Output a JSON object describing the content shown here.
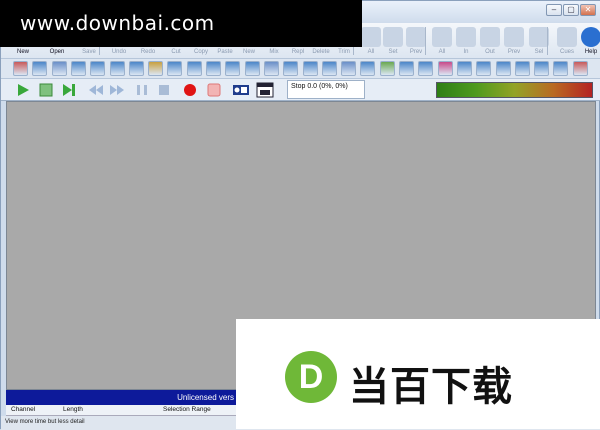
{
  "window": {
    "minimize_glyph": "–",
    "maximize_glyph": "▢",
    "close_glyph": "✕"
  },
  "toolbar_main": [
    {
      "name": "new-button",
      "label": "New",
      "icon": "new-file-icon",
      "enabled": true
    },
    {
      "name": "open-button",
      "label": "Open",
      "icon": "folder-open-icon",
      "enabled": true
    },
    {
      "name": "save-button",
      "label": "Save",
      "icon": "save-disk-icon",
      "enabled": false
    },
    {
      "name": "undo-button",
      "label": "Undo",
      "icon": "undo-arrow-icon",
      "enabled": false
    },
    {
      "name": "redo-button",
      "label": "Redo",
      "icon": "redo-arrow-icon",
      "enabled": false
    },
    {
      "name": "cut-button",
      "label": "Cut",
      "icon": "scissors-icon",
      "enabled": false
    },
    {
      "name": "copy-button",
      "label": "Copy",
      "icon": "copy-icon",
      "enabled": false
    },
    {
      "name": "paste-button",
      "label": "Paste",
      "icon": "paste-clipboard-icon",
      "enabled": false
    },
    {
      "name": "paste-new-button",
      "label": "New",
      "icon": "paste-new-icon",
      "enabled": false
    },
    {
      "name": "mix-button",
      "label": "Mix",
      "icon": "mix-icon",
      "enabled": false
    },
    {
      "name": "replace-button",
      "label": "Repl",
      "icon": "replace-icon",
      "enabled": false
    },
    {
      "name": "delete-button",
      "label": "Delete",
      "icon": "delete-icon",
      "enabled": false
    },
    {
      "name": "trim-button",
      "label": "Trim",
      "icon": "trim-icon",
      "enabled": false
    },
    {
      "name": "select-all-button",
      "label": "All",
      "icon": "select-all-icon",
      "enabled": false
    },
    {
      "name": "set-selection-button",
      "label": "Set",
      "icon": "set-selection-icon",
      "enabled": false
    },
    {
      "name": "prev-selection-button",
      "label": "Prev",
      "icon": "previous-selection-icon",
      "enabled": false
    },
    {
      "name": "zoom-all-button",
      "label": "All",
      "icon": "zoom-all-icon",
      "enabled": false
    },
    {
      "name": "zoom-in-button",
      "label": "In",
      "icon": "zoom-in-icon",
      "enabled": false
    },
    {
      "name": "zoom-out-button",
      "label": "Out",
      "icon": "zoom-out-icon",
      "enabled": false
    },
    {
      "name": "zoom-prev-button",
      "label": "Prev",
      "icon": "zoom-previous-icon",
      "enabled": false
    },
    {
      "name": "zoom-sel-button",
      "label": "Sel",
      "icon": "zoom-selection-icon",
      "enabled": false
    },
    {
      "name": "cues-button",
      "label": "Cues",
      "icon": "cue-marker-icon",
      "enabled": false
    },
    {
      "name": "help-button",
      "label": "Help",
      "icon": "help-icon",
      "enabled": true
    }
  ],
  "toolbar_effects": [
    "record-source-icon",
    "stretch-icon",
    "sphere-effect-icon",
    "noise-removal-icon",
    "wave-arrow-icon",
    "filter-icon",
    "loop-icon",
    "reverb-icon",
    "eq-icon",
    "chorus-icon",
    "insert-silence-icon",
    "fade-in-icon",
    "fade-out-icon",
    "normalize-icon",
    "center-icon",
    "equalizer-sliders-icon",
    "compressor-icon",
    "pitch-dome-icon",
    "envelope-icon",
    "spectrum-icon",
    "delay-icon",
    "flanger-icon",
    "voice-icon",
    "amplify-icon",
    "fade-ramp-icon",
    "triangle-volume-icon",
    "volume-down-icon",
    "volume-mute-icon",
    "speaker-icon",
    "dither-icon"
  ],
  "transport": {
    "play_label": "Play",
    "play_to_end_label": "Play to end",
    "stop_label": "Stop",
    "status_text": "Stop 0.0 (0%, 0%)"
  },
  "unlicensed_text": "Unlicensed vers",
  "columns": {
    "channel": "Channel",
    "length": "Length",
    "selection_range": "Selection Range"
  },
  "status_bar": {
    "hint": "View more time but less detail"
  },
  "watermarks": {
    "top": "www.downbai.com",
    "bottom_letter": "D",
    "bottom_text": "当百下载"
  },
  "colors": {
    "ribbon": "#dde6f1",
    "workspace": "#a9a9a9",
    "unlicensed_bar": "#0d1a9a",
    "play_green": "#39a83b",
    "record_red": "#e01414",
    "logo_green": "#6fb838"
  }
}
